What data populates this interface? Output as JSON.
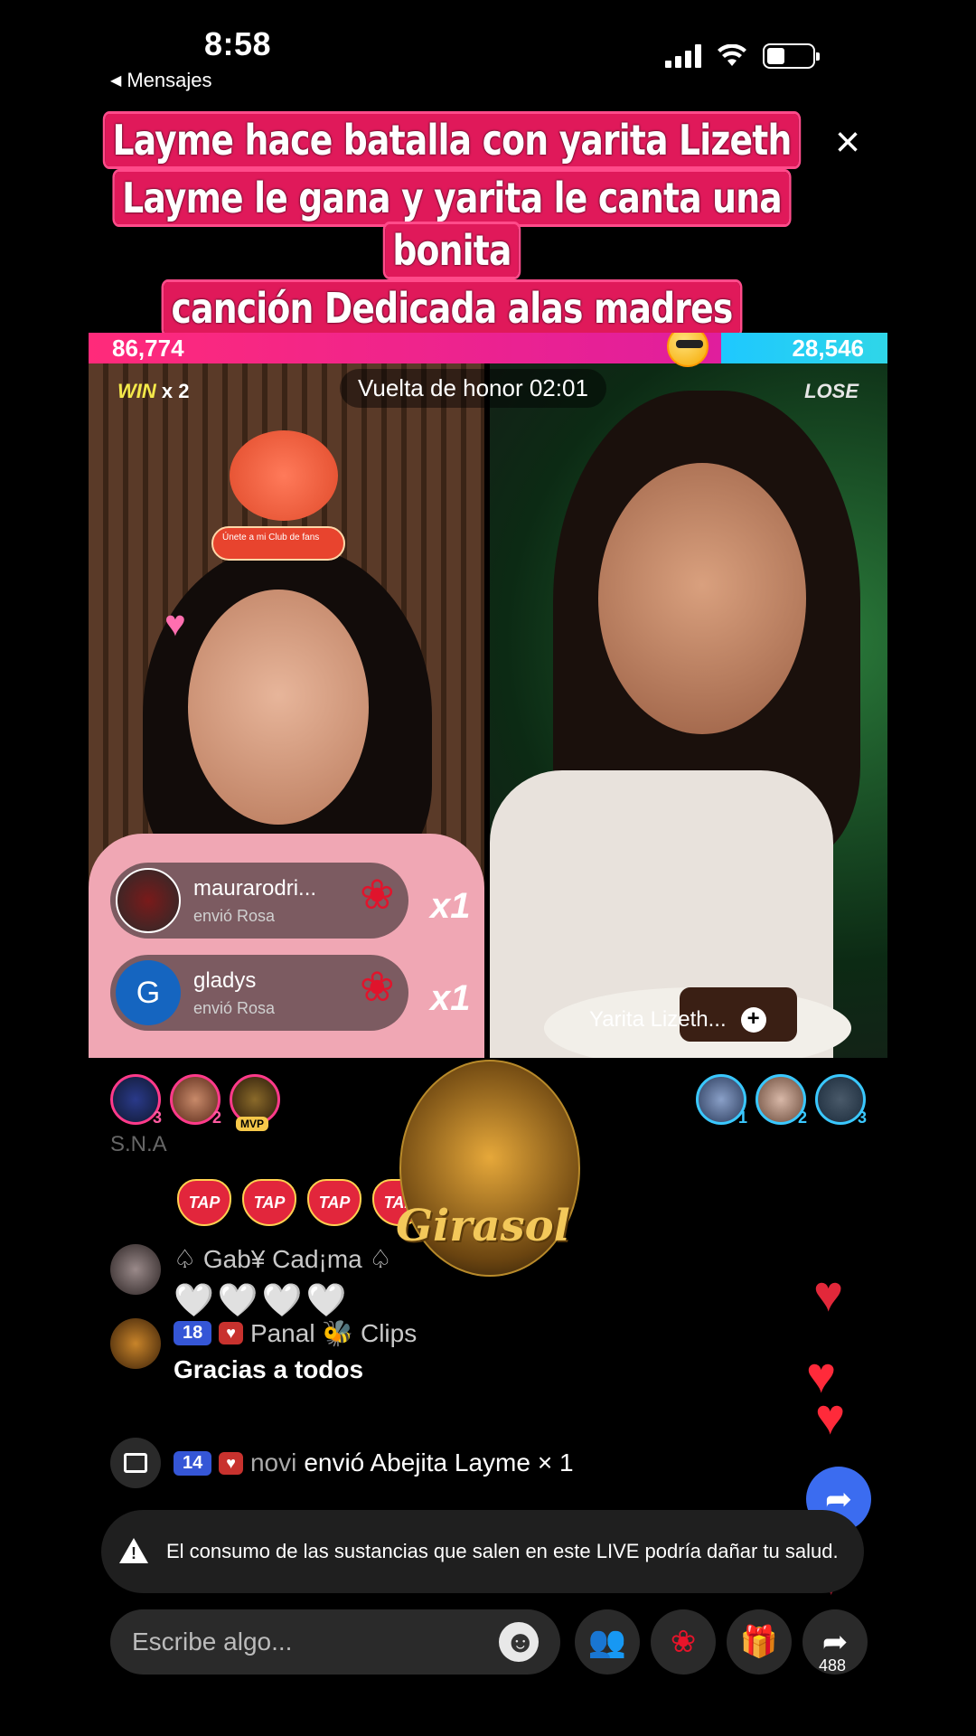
{
  "status": {
    "time": "8:58",
    "back_label": "Mensajes"
  },
  "headline": {
    "line1": "Layme hace batalla  con yarita Lizeth",
    "line2": "Layme le gana y yarita le canta una bonita",
    "line3": "canción  Dedicada alas madres",
    "close": "×"
  },
  "battle": {
    "score_left": "86,774",
    "score_right": "28,546",
    "win_label": "WIN",
    "win_multiplier": "x 2",
    "lose_label": "LOSE",
    "round_label": "Vuelta de honor  02:01",
    "fanclub_button": "Únete a mi Club de fans",
    "gifts": [
      {
        "user": "maurarodri...",
        "action": "envió Rosa",
        "count": "x1",
        "avatar_letter": ""
      },
      {
        "user": "gladys",
        "action": "envió Rosa",
        "count": "x1",
        "avatar_letter": "G"
      }
    ],
    "opponent_name": "Yarita Lizeth...",
    "opponent_follow": "+"
  },
  "supporters": {
    "left": [
      {
        "rank": "3"
      },
      {
        "rank": "2"
      },
      {
        "rank": "MVP"
      }
    ],
    "right": [
      {
        "rank": "1"
      },
      {
        "rank": "2"
      },
      {
        "rank": "3"
      }
    ]
  },
  "watermark": {
    "text": "Girasol"
  },
  "chat": {
    "partial": "S.N.A",
    "tap_label": "TAP",
    "messages": [
      {
        "user": "♤ Gab¥ Cad¡ma ♤",
        "text": "🤍🤍🤍🤍"
      },
      {
        "level": "18",
        "user": "Panal 🐝 Clips",
        "text": "Gracias a todos"
      },
      {
        "level": "14",
        "user": "novi",
        "text": "envió Abejita Layme",
        "count": "× 1"
      }
    ]
  },
  "warning": {
    "text": "El consumo de las sustancias que salen en este LIVE podría dañar tu salud."
  },
  "input": {
    "placeholder": "Escribe algo..."
  },
  "share": {
    "count": "488"
  },
  "colors": {
    "accent_pink": "#e0195a",
    "team_red": "#ff2a7a",
    "team_blue": "#1ec8ff"
  },
  "icons": [
    "signal-icon",
    "wifi-icon",
    "battery-icon",
    "close-icon",
    "heart-icon",
    "rose-icon",
    "gift-icon",
    "smile-icon",
    "people-icon",
    "share-icon",
    "warning-icon"
  ]
}
